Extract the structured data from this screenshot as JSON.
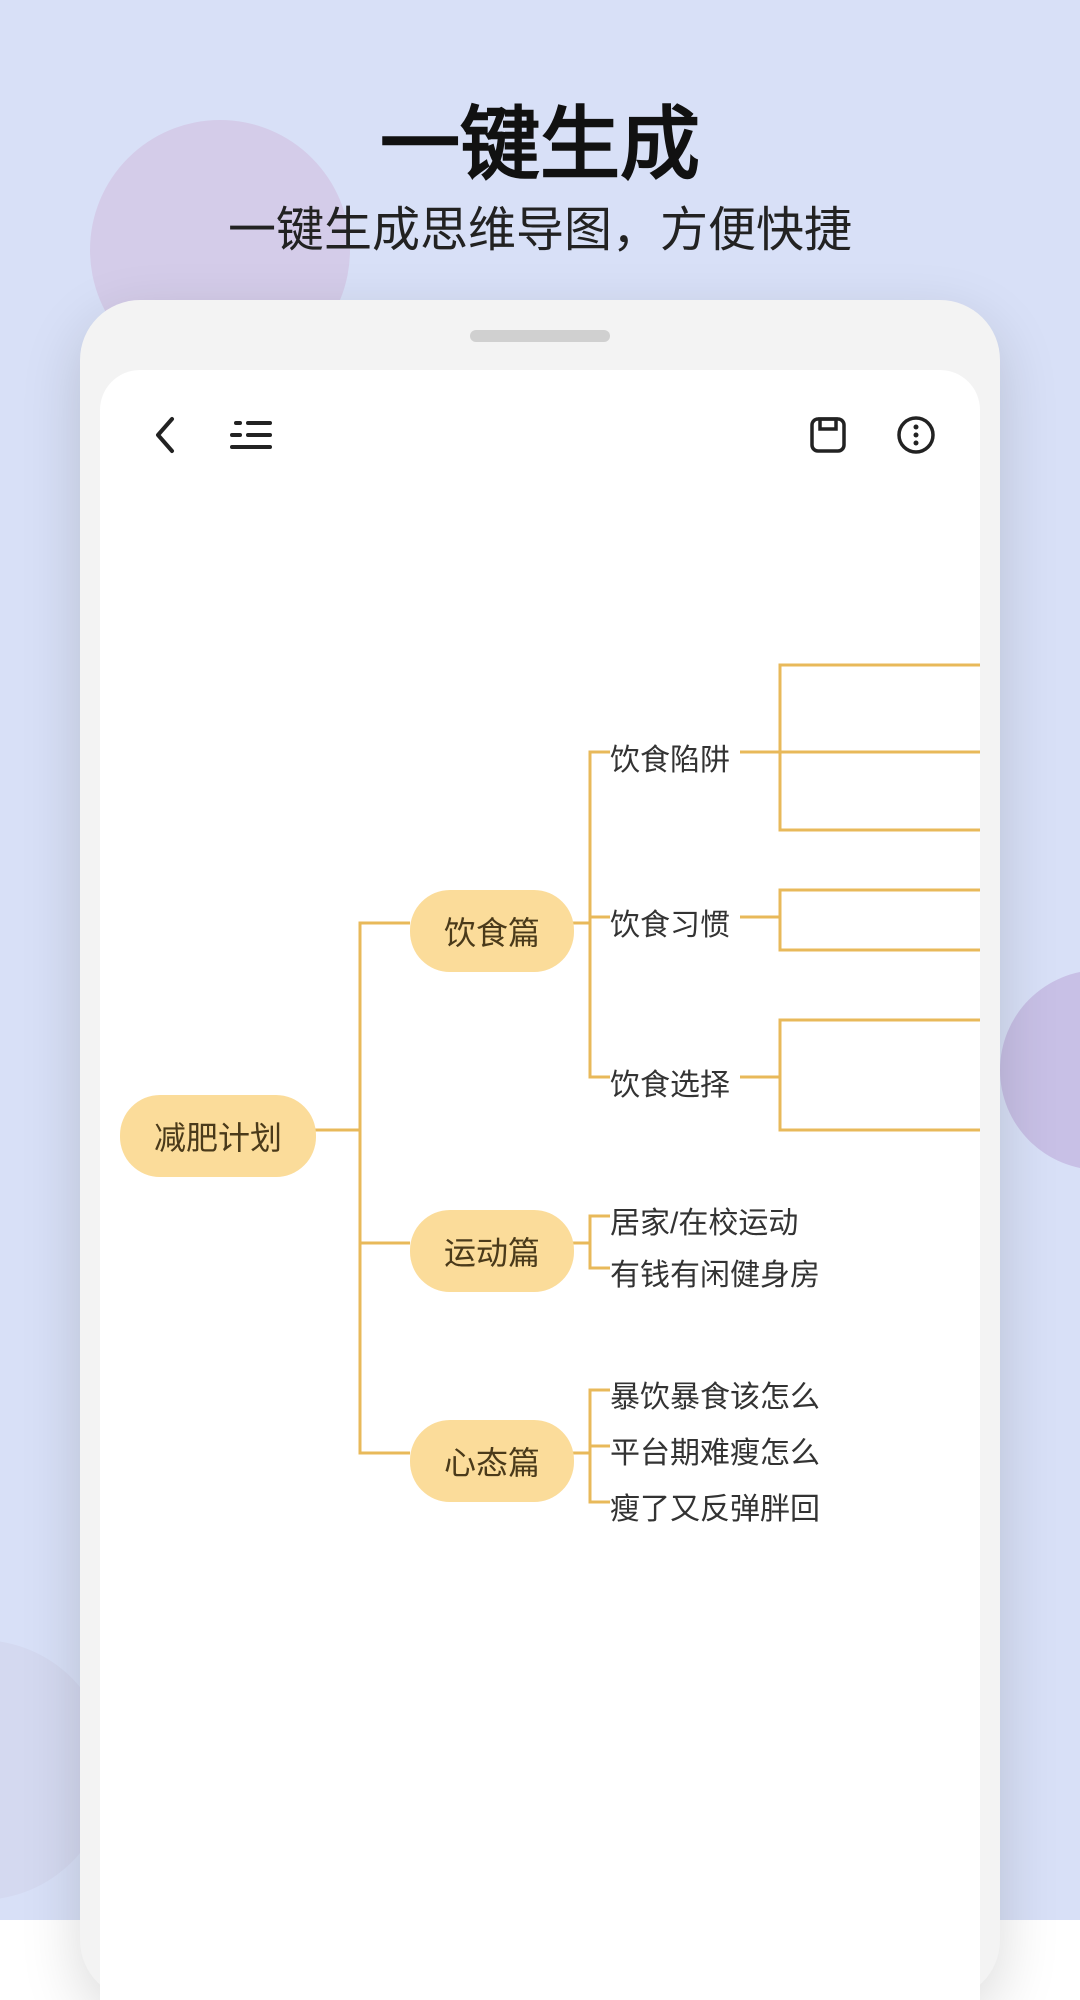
{
  "promo": {
    "headline": "一键生成",
    "subhead": "一键生成思维导图，方便快捷"
  },
  "toolbar": {
    "icons": {
      "back": "back-icon",
      "outline": "outline-icon",
      "save": "save-icon",
      "more": "more-icon"
    }
  },
  "mindmap": {
    "root": "减肥计划",
    "children": [
      {
        "label": "饮食篇",
        "children": [
          {
            "label": "饮食陷阱"
          },
          {
            "label": "饮食习惯"
          },
          {
            "label": "饮食选择"
          }
        ]
      },
      {
        "label": "运动篇",
        "children": [
          {
            "label": "居家/在校运动"
          },
          {
            "label": "有钱有闲健身房"
          }
        ]
      },
      {
        "label": "心态篇",
        "children": [
          {
            "label": "暴饮暴食该怎么"
          },
          {
            "label": "平台期难瘦怎么"
          },
          {
            "label": "瘦了又反弹胖回"
          }
        ]
      }
    ]
  }
}
